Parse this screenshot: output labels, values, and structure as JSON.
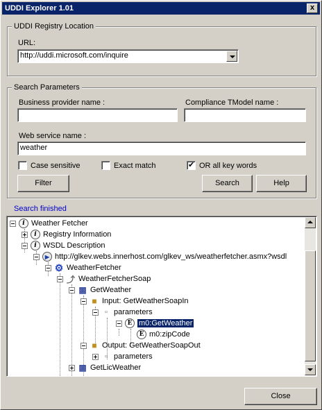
{
  "window": {
    "title": "UDDI Explorer 1.01",
    "close_glyph": "x"
  },
  "registry": {
    "legend": "UDDI Registry Location",
    "url_label": "URL:",
    "url_value": "http://uddi.microsoft.com/inquire"
  },
  "search": {
    "legend": "Search Parameters",
    "business_label": "Business provider name :",
    "business_value": "",
    "tmodel_label": "Compliance TModel name :",
    "tmodel_value": "",
    "service_label": "Web service name :",
    "service_value": "weather",
    "case_sensitive_label": "Case sensitive",
    "case_sensitive_checked": false,
    "exact_match_label": "Exact match",
    "exact_match_checked": false,
    "or_keywords_label": "OR all key words",
    "or_keywords_checked": true,
    "filter_button": "Filter",
    "search_button": "Search",
    "help_button": "Help"
  },
  "status_text": "Search finished",
  "tree": {
    "nodes": [
      {
        "label": "Weather Fetcher",
        "icon": "info-icon",
        "expander": "minus"
      },
      {
        "label": "Registry Information",
        "icon": "info-icon",
        "expander": "plus"
      },
      {
        "label": "WSDL Description",
        "icon": "info-icon",
        "expander": "minus"
      },
      {
        "label": "http://glkev.webs.innerhost.com/glkev_ws/weatherfetcher.asmx?wsdl",
        "icon": "link-icon",
        "expander": "minus"
      },
      {
        "label": "WeatherFetcher",
        "icon": "gear-icon",
        "expander": "minus"
      },
      {
        "label": "WeatherFetcherSoap",
        "icon": "port-icon",
        "expander": "minus"
      },
      {
        "label": "GetWeather",
        "icon": "operation-icon",
        "expander": "minus"
      },
      {
        "label": "Input: GetWeatherSoapIn",
        "icon": "message-icon",
        "expander": "minus"
      },
      {
        "label": "parameters",
        "icon": "parameter-icon",
        "expander": "minus"
      },
      {
        "label": "m0:GetWeather",
        "icon": "element-icon",
        "expander": "minus",
        "selected": true
      },
      {
        "label": "m0:zipCode",
        "icon": "element-icon",
        "expander": "none"
      },
      {
        "label": "Output: GetWeatherSoapOut",
        "icon": "message-icon",
        "expander": "minus"
      },
      {
        "label": "parameters",
        "icon": "parameter-icon",
        "expander": "plus"
      },
      {
        "label": "GetLicWeather",
        "icon": "operation-icon",
        "expander": "plus"
      }
    ]
  },
  "close_button": "Close",
  "colors": {
    "titlebar": "#0a246a",
    "face": "#d4d0c8",
    "selection": "#0a246a",
    "status": "#0000cc"
  }
}
